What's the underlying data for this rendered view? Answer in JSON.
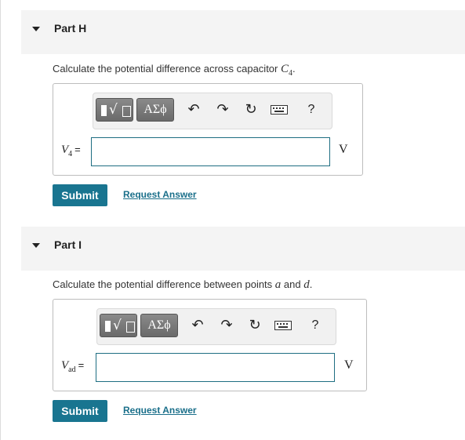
{
  "parts": [
    {
      "title": "Part H",
      "question": {
        "text": "Calculate the potential difference across capacitor ",
        "symbol": "C",
        "symbol_sub": "4",
        "suffix": "."
      },
      "variable": {
        "symbol": "V",
        "sub": "4",
        "eq": "="
      },
      "input_value": "",
      "unit": "V",
      "toolbar": {
        "greek_label": "ΑΣϕ",
        "help_label": "?"
      },
      "submit_label": "Submit",
      "request_label": "Request Answer"
    },
    {
      "title": "Part I",
      "question": {
        "text": "Calculate the potential difference between points ",
        "a": "a",
        "and": " and ",
        "d": "d",
        "suffix": "."
      },
      "variable": {
        "symbol": "V",
        "sub": "ad",
        "eq": "="
      },
      "input_value": "",
      "unit": "V",
      "toolbar": {
        "greek_label": "ΑΣϕ",
        "help_label": "?"
      },
      "submit_label": "Submit",
      "request_label": "Request Answer"
    }
  ],
  "icons": {
    "collapse": "caret-down-icon",
    "templates": "templates-icon",
    "undo": "undo-icon",
    "redo": "redo-icon",
    "reset": "reset-icon",
    "keyboard": "keyboard-icon",
    "help": "help-icon"
  },
  "colors": {
    "accent": "#197590",
    "link": "#1a6f8a",
    "header_bg": "#f4f4f4",
    "input_border": "#1e6e82"
  }
}
